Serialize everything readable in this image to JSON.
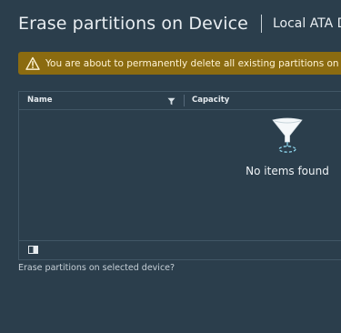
{
  "dialog": {
    "title": "Erase partitions on Device",
    "subtitle": "Local ATA Disk (na",
    "warning": "You are about to permanently delete all existing partitions on the device",
    "question": "Erase partitions on selected device?"
  },
  "table": {
    "columns": [
      {
        "label": "Name"
      },
      {
        "label": "Capacity"
      }
    ],
    "empty_message": "No items found"
  },
  "colors": {
    "background": "#2b3e4c",
    "warning_background": "#8b6b10",
    "border": "#415665",
    "accent_cyan": "#8fd8ef"
  },
  "icons": {
    "warning": "warning-triangle-icon",
    "filter": "filter-icon",
    "empty": "empty-funnel-icon",
    "column_toggle": "column-toggle-icon"
  }
}
